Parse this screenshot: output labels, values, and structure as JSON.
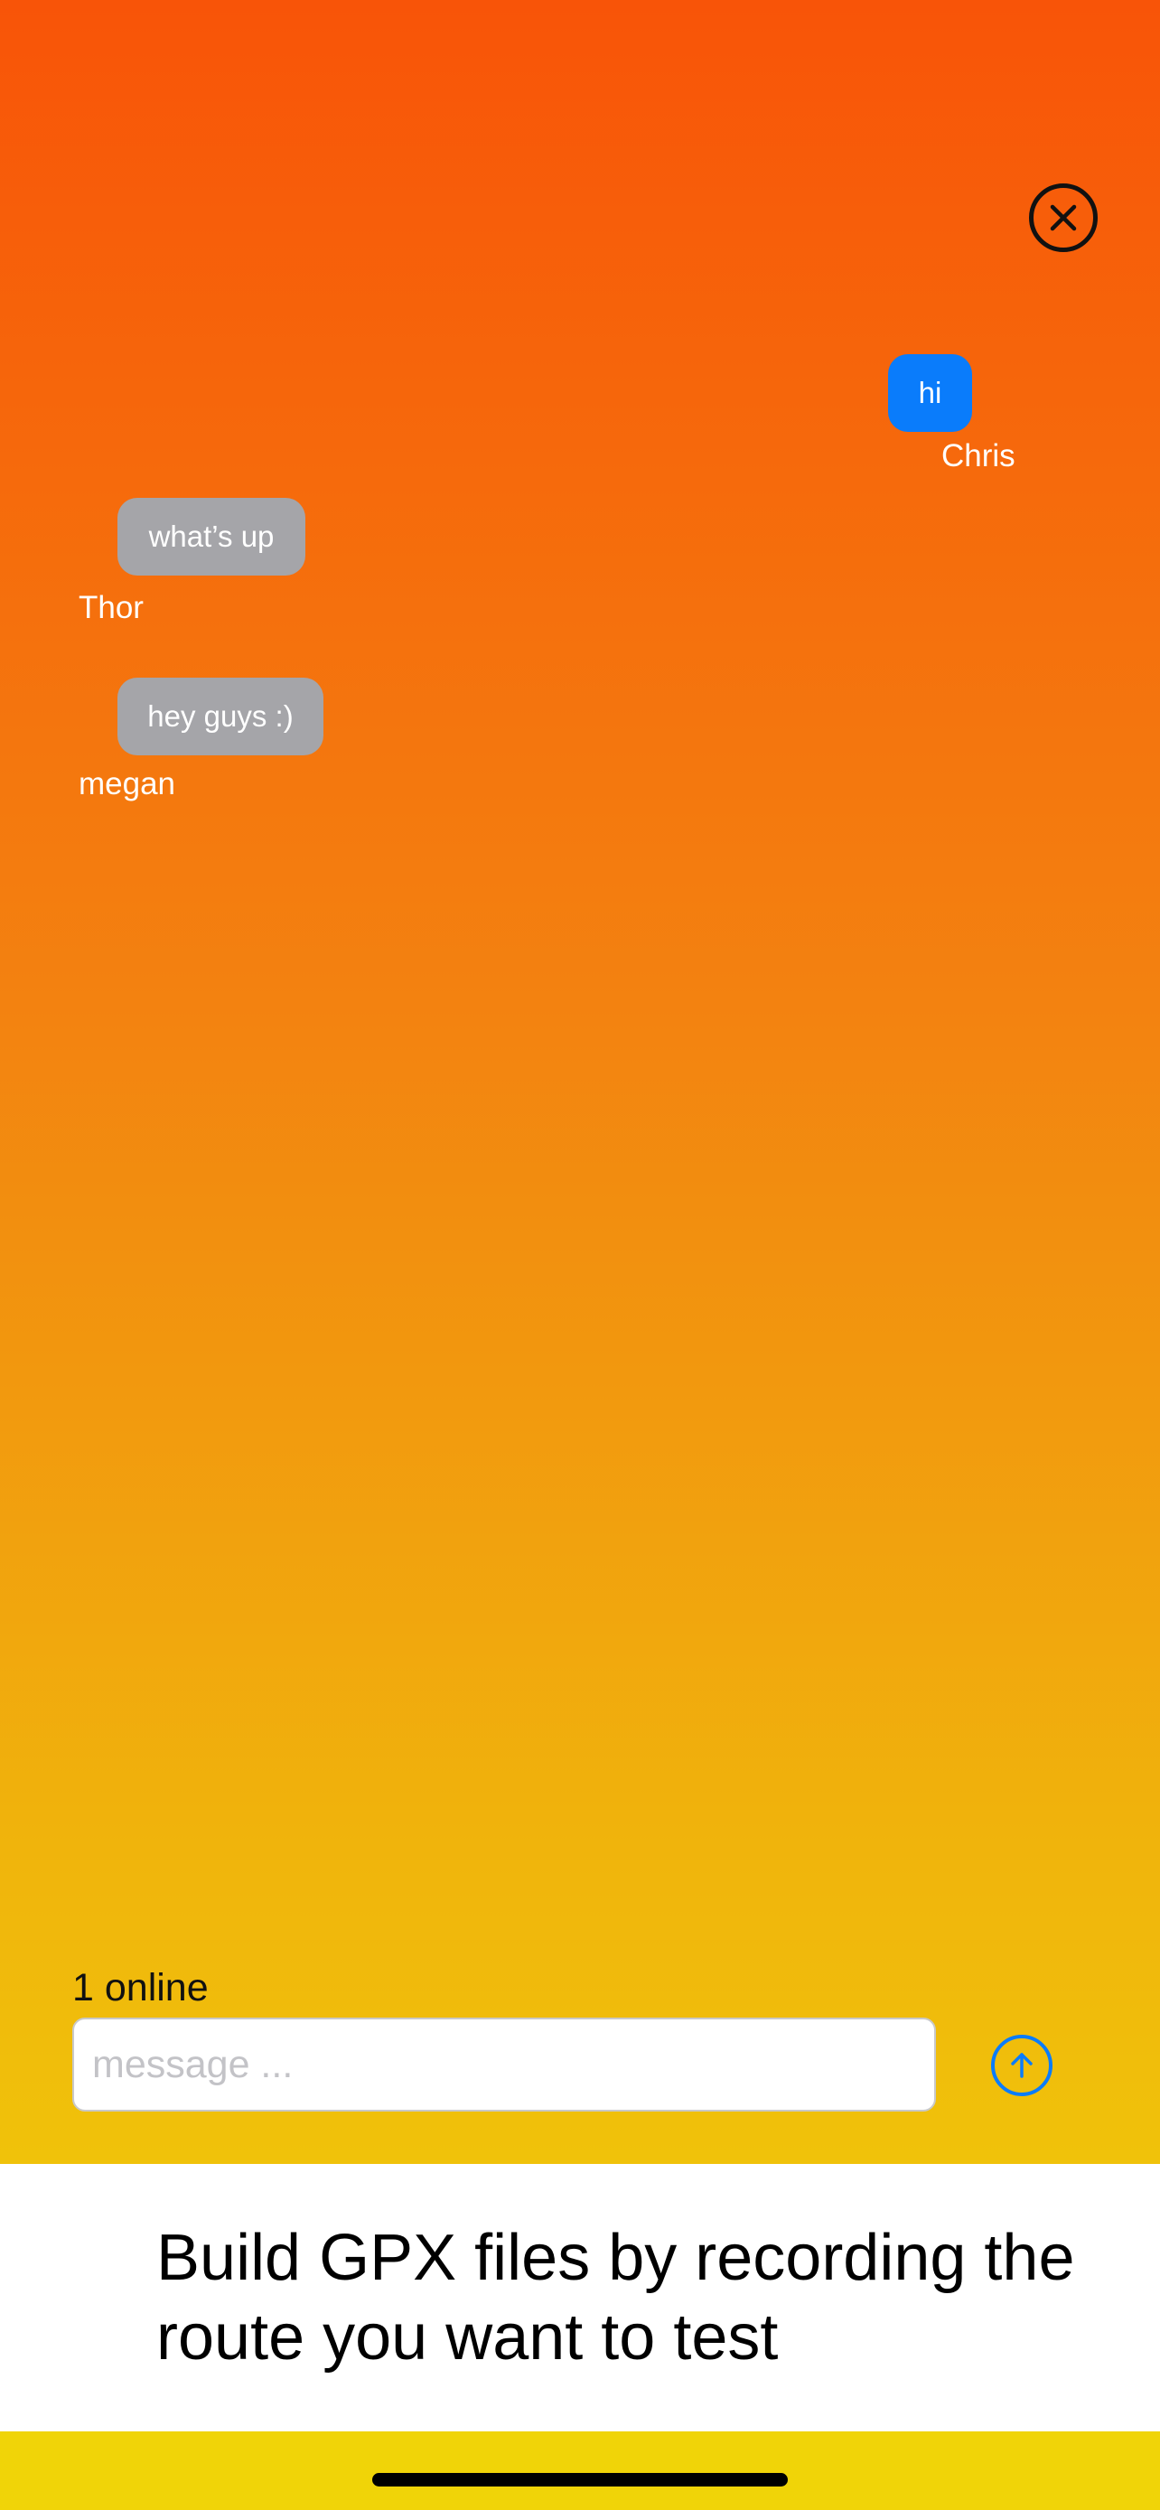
{
  "messages": [
    {
      "text": "hi",
      "sender": "Chris",
      "mine": true
    },
    {
      "text": "what’s up",
      "sender": "Thor",
      "mine": false
    },
    {
      "text": "hey guys :)",
      "sender": "megan",
      "mine": false
    }
  ],
  "status": {
    "online": "1 online"
  },
  "composer": {
    "placeholder": "message ..."
  },
  "banner": {
    "text": "Build GPX files by recording the route you want to test"
  },
  "icons": {
    "close": "close-circle-icon",
    "send": "arrow-up-circle-icon"
  },
  "colors": {
    "accent": "#0a7cfb",
    "bubble_other": "#a5a5a9",
    "gradient_top": "#f85408",
    "gradient_bottom": "#f1d108"
  }
}
